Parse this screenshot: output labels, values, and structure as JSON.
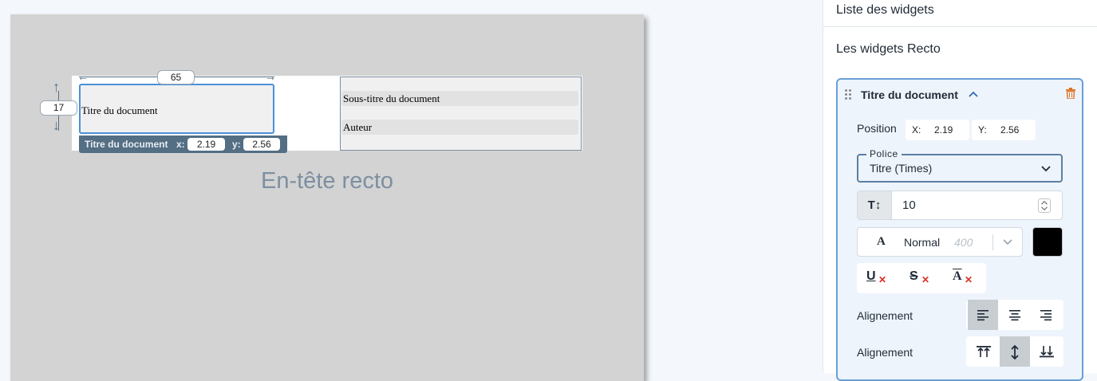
{
  "canvas": {
    "title_widget_label": "Titre du document",
    "subtitle_widget_label": "Sous-titre du document",
    "author_widget_label": "Auteur",
    "width_badge": "65",
    "height_badge": "17",
    "position_bar": {
      "name": "Titre du document",
      "x_label": "x:",
      "x_value": "2.19",
      "y_label": "y:",
      "y_value": "2.56"
    },
    "section_heading": "En-tête recto"
  },
  "panel": {
    "header": "Liste des widgets",
    "section_title": "Les widgets Recto",
    "card": {
      "title": "Titre du document",
      "position_label": "Position",
      "x_label": "X:",
      "x_value": "2.19",
      "y_label": "Y:",
      "y_value": "2.56",
      "font_legend": "Police",
      "font_value": "Titre (Times)",
      "size_icon": "T↕",
      "size_value": "10",
      "weight_icon": "A",
      "weight_name": "Normal",
      "weight_value": "400",
      "text_color": "#000000",
      "align_h_label": "Alignement",
      "align_v_label": "Alignement",
      "icons": {
        "drag": "drag-handle-icon",
        "collapse": "chevron-up-icon",
        "delete": "trash-icon"
      }
    }
  },
  "colors": {
    "accent": "#6a9fd8",
    "bar": "#546e84",
    "delete": "#e07020"
  }
}
